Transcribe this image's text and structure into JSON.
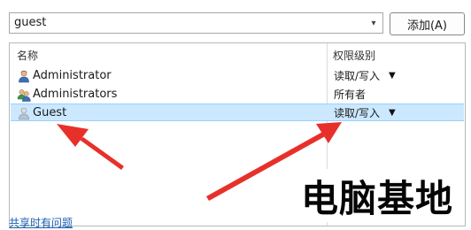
{
  "user_combo": {
    "value": "guest",
    "arrow": "▾"
  },
  "add_button": {
    "label": "添加(A)"
  },
  "list": {
    "headers": {
      "name": "名称",
      "permission": "权限级别"
    },
    "rows": [
      {
        "name": "Administrator",
        "permission": "读取/写入",
        "has_dropdown": true,
        "icon": "user-icon"
      },
      {
        "name": "Administrators",
        "permission": "所有者",
        "has_dropdown": false,
        "icon": "group-icon"
      },
      {
        "name": "Guest",
        "permission": "读取/写入",
        "has_dropdown": true,
        "icon": "guest-user-icon",
        "selected": true
      }
    ],
    "dropdown_glyph": "▼"
  },
  "watermark": {
    "text": "电脑基地"
  },
  "bottom_link": {
    "label": "共享时有问题"
  },
  "colors": {
    "selection_bg": "#cce8ff",
    "annotation_arrow": "#e8302a",
    "link": "#1a5fb4"
  }
}
